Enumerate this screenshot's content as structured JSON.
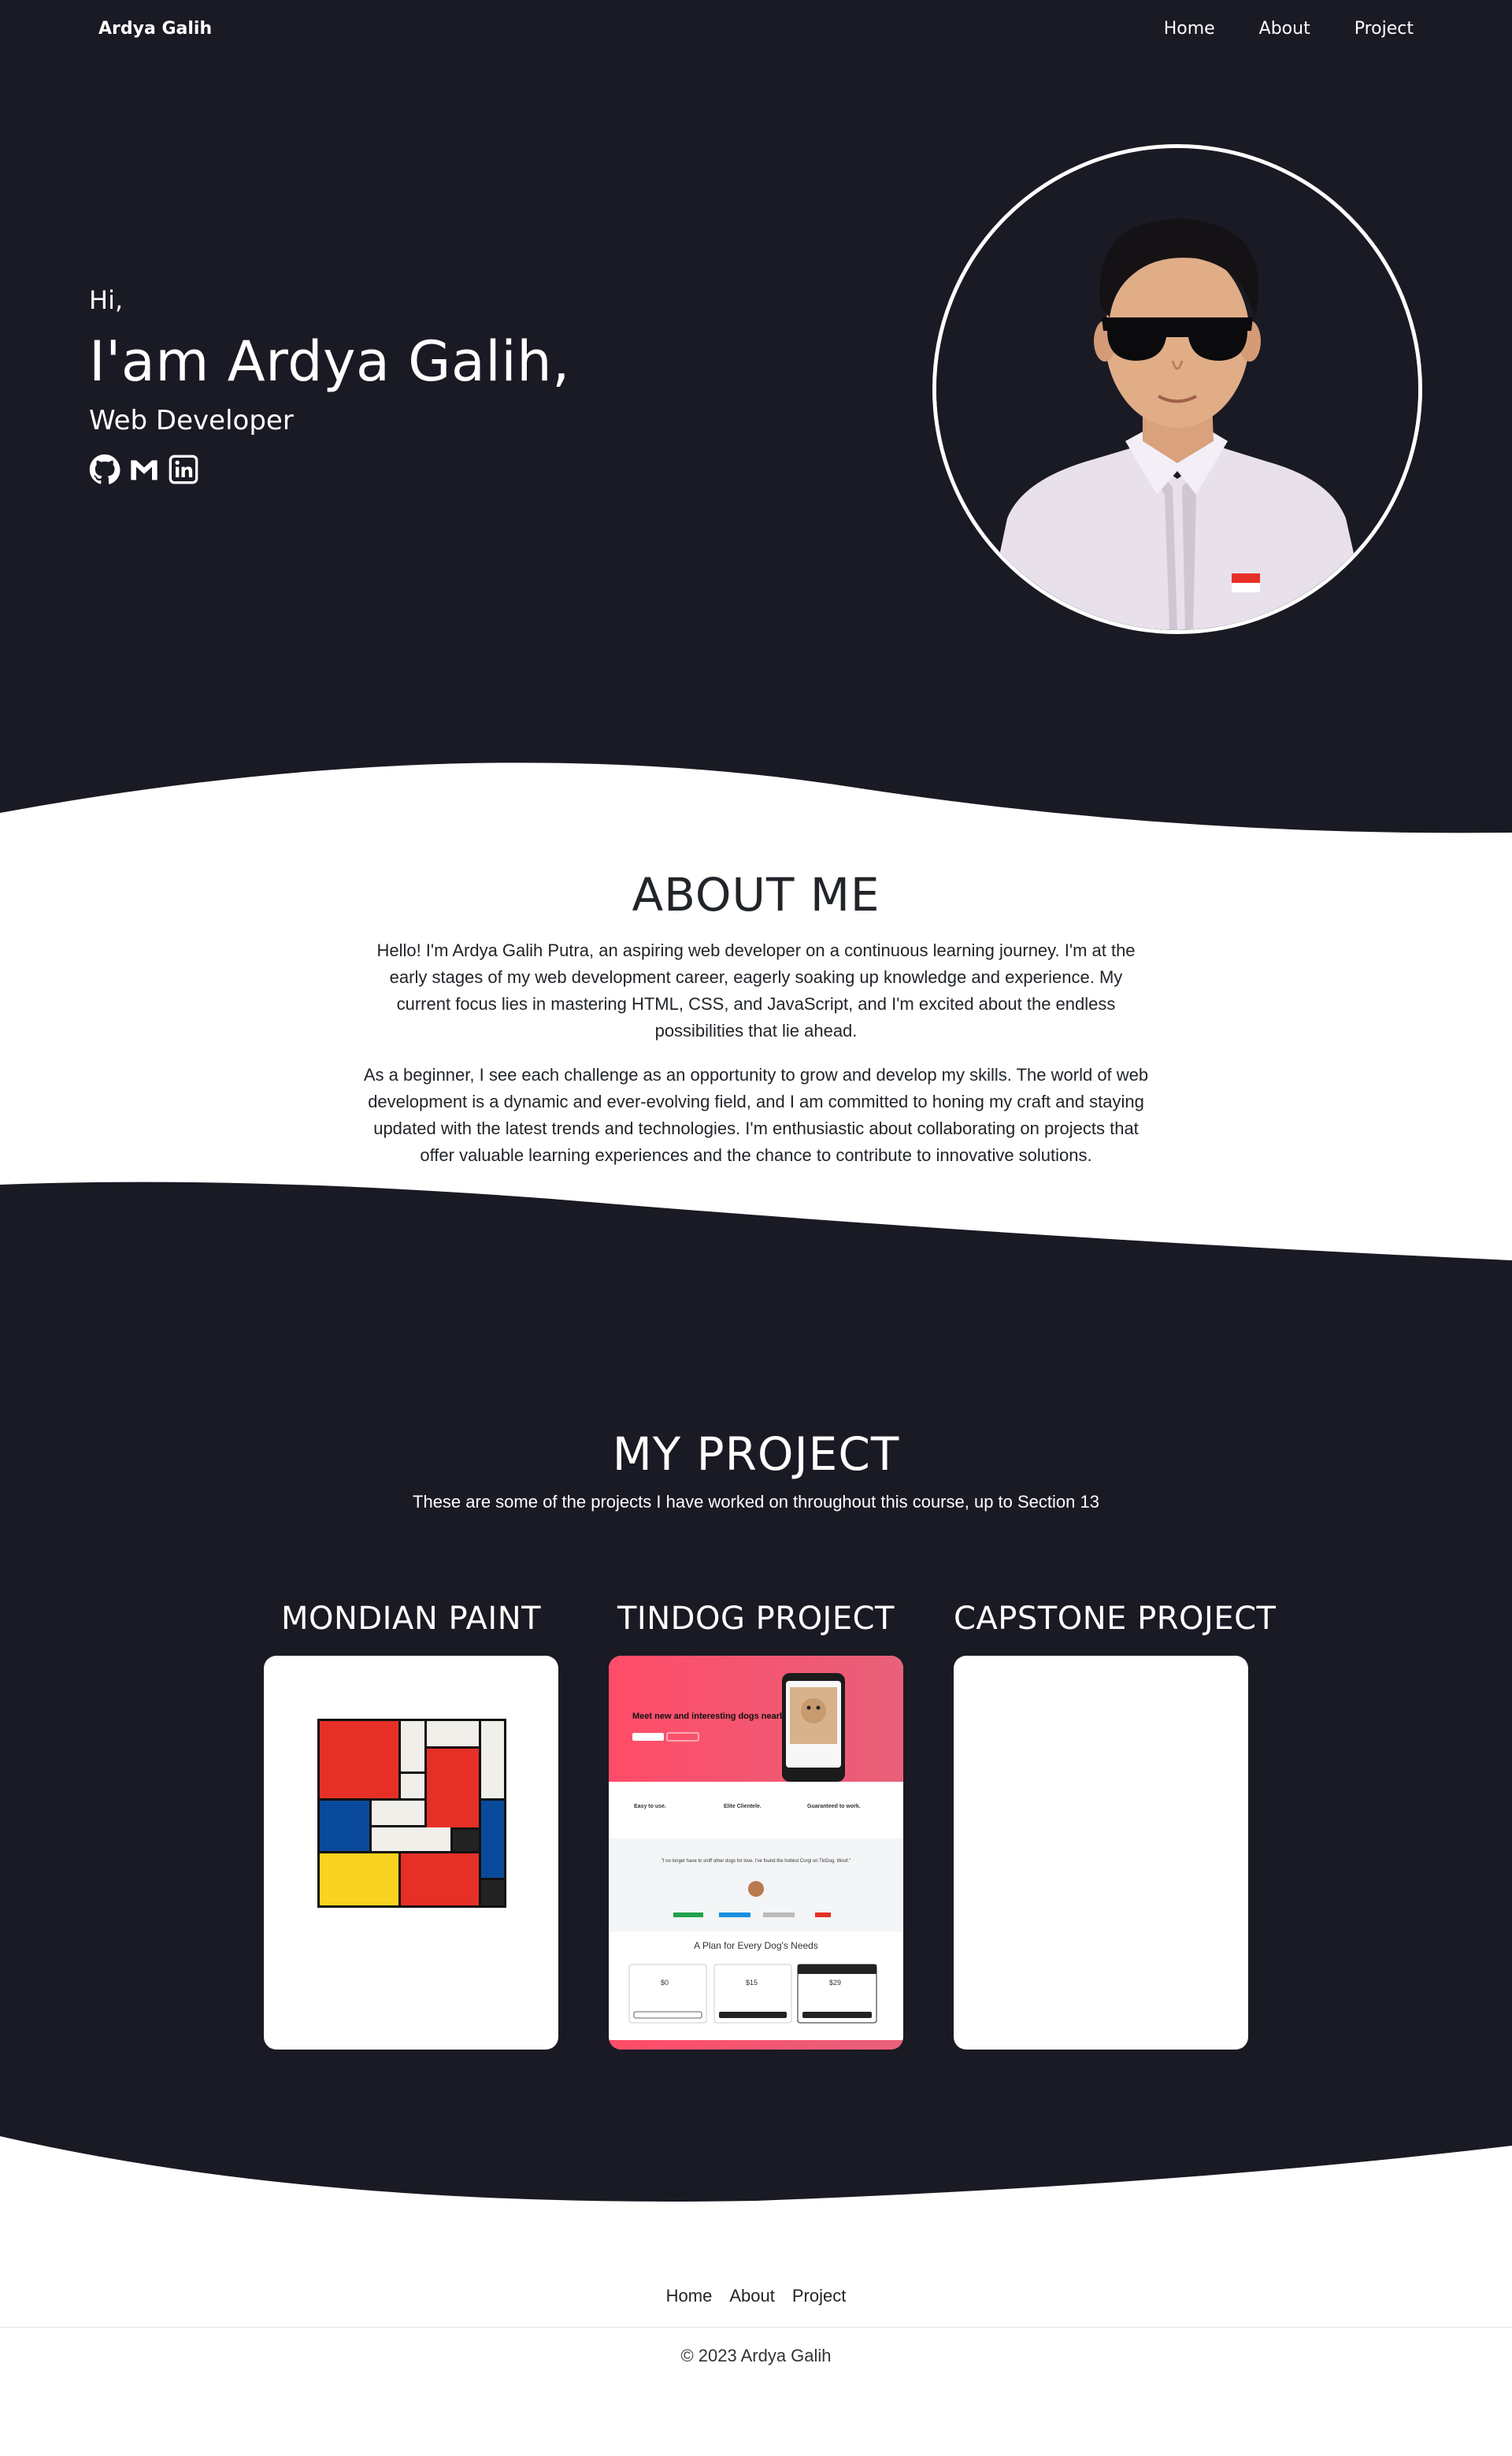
{
  "navbar": {
    "brand": "Ardya Galih",
    "links": [
      "Home",
      "About",
      "Project"
    ]
  },
  "hero": {
    "greeting": "Hi,",
    "name": "I'am Ardya Galih,",
    "role": "Web Developer",
    "socials": [
      "github-icon",
      "gmail-icon",
      "linkedin-icon"
    ]
  },
  "about": {
    "title": "ABOUT ME",
    "paragraph1": "Hello! I'm Ardya Galih Putra, an aspiring web developer on a continuous learning journey. I'm at the early stages of my web development career, eagerly soaking up knowledge and experience. My current focus lies in mastering HTML, CSS, and JavaScript, and I'm excited about the endless possibilities that lie ahead.",
    "paragraph2": "As a beginner, I see each challenge as an opportunity to grow and develop my skills. The world of web development is a dynamic and ever-evolving field, and I am committed to honing my craft and staying updated with the latest trends and technologies. I'm enthusiastic about collaborating on projects that offer valuable learning experiences and the chance to contribute to innovative solutions."
  },
  "projects": {
    "title": "MY PROJECT",
    "subtitle": "These are some of the projects I have worked on throughout this course, up to Section 13",
    "items": [
      {
        "title": "MONDIAN PAINT"
      },
      {
        "title": "TINDOG PROJECT"
      },
      {
        "title": "CAPSTONE PROJECT"
      }
    ],
    "tindog": {
      "headline": "Meet new and interesting dogs nearby.",
      "feature1": "Easy to use.",
      "feature2": "Elite Clientele.",
      "feature3": "Guaranteed to work.",
      "testimonial": "\"I no longer have to sniff other dogs for love. I've found the hottest Corgi on TinDog. Woof.\"",
      "plans_title": "A Plan for Every Dog's Needs",
      "price1": "$0",
      "price2": "$15",
      "price3": "$29"
    }
  },
  "footer": {
    "links": [
      "Home",
      "About",
      "Project"
    ],
    "copyright": "© 2023 Ardya Galih"
  },
  "colors": {
    "dark_bg": "#1a1a24",
    "white": "#ffffff",
    "mondrian_red": "#e63027",
    "mondrian_blue": "#0a4a9c",
    "mondrian_yellow": "#f9d320",
    "tindog_pink": "#ff4c68"
  }
}
